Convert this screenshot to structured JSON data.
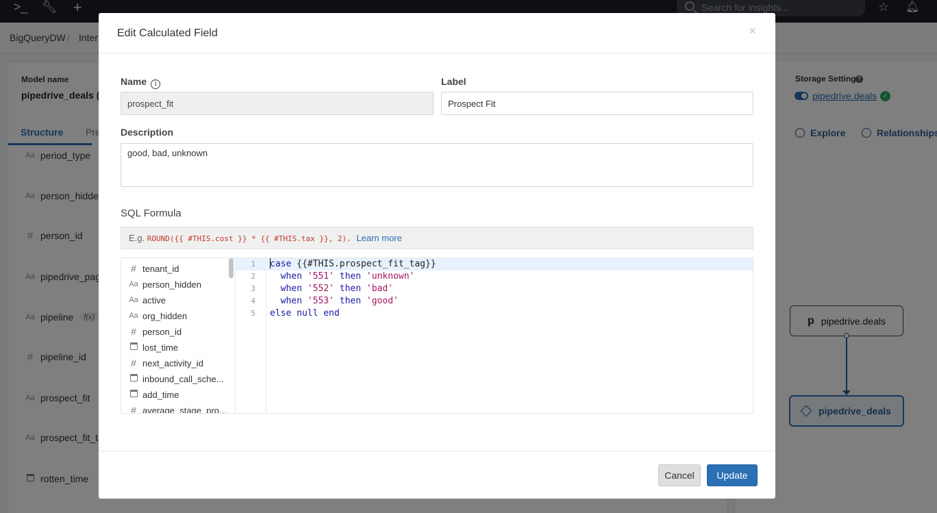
{
  "topbar": {
    "icons": [
      "terminal-icon",
      "wrench-icon",
      "plus-icon",
      "star-icon",
      "bell-icon"
    ],
    "search_placeholder": "Search for insights..."
  },
  "breadcrumb": {
    "items": [
      "BigQueryDW",
      "Inter"
    ]
  },
  "model": {
    "label": "Model name",
    "value": "pipedrive_deals (D",
    "tabs": [
      "Structure",
      "Pre"
    ]
  },
  "bg_fields": [
    {
      "type": "Aa",
      "name": "period_type"
    },
    {
      "type": "Aa",
      "name": "person_hidden"
    },
    {
      "type": "#",
      "name": "person_id"
    },
    {
      "type": "Aa",
      "name": "pipedrive_pag"
    },
    {
      "type": "Aa",
      "name": "pipeline",
      "badge": "f(x)"
    },
    {
      "type": "#",
      "name": "pipeline_id"
    },
    {
      "type": "Aa",
      "name": "prospect_fit"
    },
    {
      "type": "Aa",
      "name": "prospect_fit_ta"
    },
    {
      "type": "cal",
      "name": "rotten_time"
    }
  ],
  "right_panel": {
    "storage_label": "Storage Setting",
    "storage_link": "pipedrive.deals",
    "explore": "Explore",
    "relationships": "Relationships",
    "node_source": "pipedrive.deals",
    "node_source_logo": "p",
    "node_target": "pipedrive_deals"
  },
  "modal": {
    "title": "Edit Calculated Field",
    "close": "×",
    "name_label": "Name",
    "name_value": "prospect_fit",
    "label_label": "Label",
    "label_value": "Prospect Fit",
    "description_label": "Description",
    "description_value": "good, bad, unknown",
    "sql_label": "SQL Formula",
    "example_prefix": "E.g.",
    "example_code": "ROUND({{ #THIS.cost }} * {{ #THIS.tax }}, 2).",
    "learn_more": "Learn more",
    "field_list": [
      {
        "type": "#",
        "name": "tenant_id"
      },
      {
        "type": "Aa",
        "name": "person_hidden"
      },
      {
        "type": "Aa",
        "name": "active"
      },
      {
        "type": "Aa",
        "name": "org_hidden"
      },
      {
        "type": "#",
        "name": "person_id"
      },
      {
        "type": "cal",
        "name": "lost_time"
      },
      {
        "type": "#",
        "name": "next_activity_id"
      },
      {
        "type": "cal",
        "name": "inbound_call_sche..."
      },
      {
        "type": "cal",
        "name": "add_time"
      },
      {
        "type": "#",
        "name": "average_stage_pro..."
      }
    ],
    "line_numbers": [
      "1",
      "2",
      "3",
      "4",
      "5"
    ],
    "code": {
      "l1_kw": "case",
      "l1_rest": " {{#THIS.prospect_fit_tag}}",
      "l2_kw1": "when",
      "l2_str1": "'551'",
      "l2_kw2": "then",
      "l2_str2": "'unknown'",
      "l3_kw1": "when",
      "l3_str1": "'552'",
      "l3_kw2": "then",
      "l3_str2": "'bad'",
      "l4_kw1": "when",
      "l4_str1": "'553'",
      "l4_kw2": "then",
      "l4_str2": "'good'",
      "l5": "else null end"
    },
    "cancel": "Cancel",
    "update": "Update"
  }
}
